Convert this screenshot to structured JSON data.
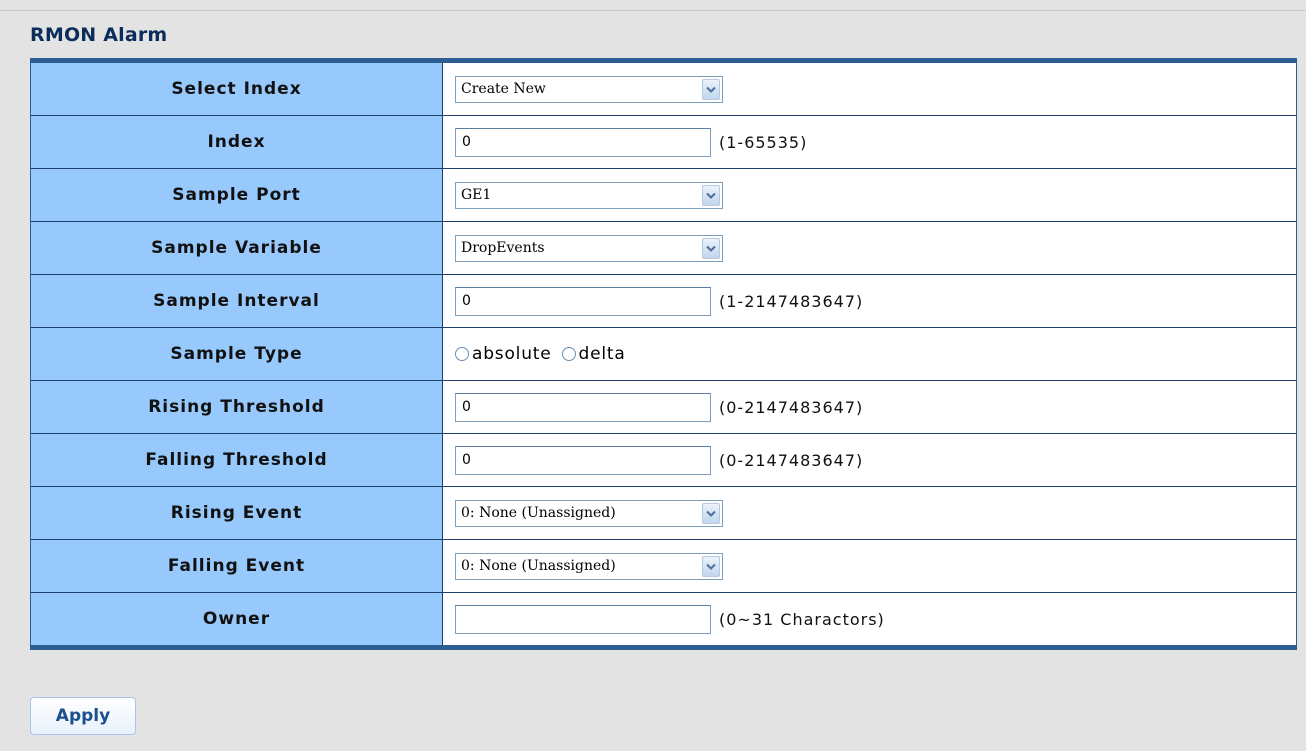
{
  "page": {
    "title": "RMON Alarm"
  },
  "form": {
    "select_index": {
      "label": "Select Index",
      "value": "Create New"
    },
    "index": {
      "label": "Index",
      "value": "0",
      "hint": "(1-65535)"
    },
    "sample_port": {
      "label": "Sample Port",
      "value": "GE1"
    },
    "sample_variable": {
      "label": "Sample Variable",
      "value": "DropEvents"
    },
    "sample_interval": {
      "label": "Sample Interval",
      "value": "0",
      "hint": "(1-2147483647)"
    },
    "sample_type": {
      "label": "Sample Type",
      "options": [
        "absolute",
        "delta"
      ],
      "selected": null
    },
    "rising_threshold": {
      "label": "Rising Threshold",
      "value": "0",
      "hint": "(0-2147483647)"
    },
    "falling_threshold": {
      "label": "Falling Threshold",
      "value": "0",
      "hint": "(0-2147483647)"
    },
    "rising_event": {
      "label": "Rising Event",
      "value": "0: None (Unassigned)"
    },
    "falling_event": {
      "label": "Falling Event",
      "value": "0: None (Unassigned)"
    },
    "owner": {
      "label": "Owner",
      "value": "",
      "hint": "(0~31 Charactors)"
    }
  },
  "actions": {
    "apply_label": "Apply"
  },
  "colors": {
    "label_bg": "#98c9fc",
    "border_accent": "#2d5e93",
    "page_bg": "#e3e3e3",
    "title_color": "#0a2d5c"
  },
  "icons": {
    "dropdown": "chevron-down-icon",
    "radio": "radio-icon"
  }
}
